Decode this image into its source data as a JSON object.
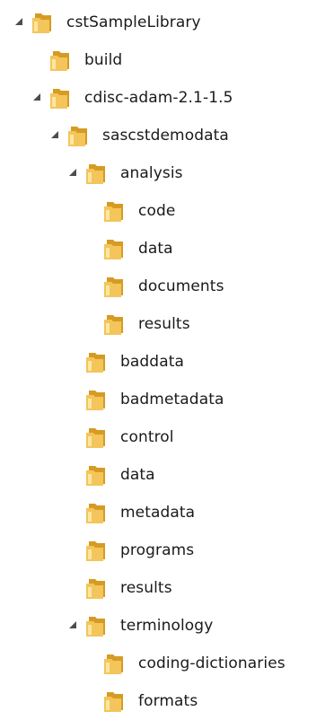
{
  "tree": {
    "nodes": [
      {
        "label": "cstSampleLibrary",
        "depth": 0,
        "expanded": true,
        "has_children": true,
        "icon": "folder-icon"
      },
      {
        "label": "build",
        "depth": 1,
        "expanded": false,
        "has_children": false,
        "icon": "folder-icon"
      },
      {
        "label": "cdisc-adam-2.1-1.5",
        "depth": 1,
        "expanded": true,
        "has_children": true,
        "icon": "folder-icon"
      },
      {
        "label": "sascstdemodata",
        "depth": 2,
        "expanded": true,
        "has_children": true,
        "icon": "folder-icon"
      },
      {
        "label": "analysis",
        "depth": 3,
        "expanded": true,
        "has_children": true,
        "icon": "folder-icon"
      },
      {
        "label": "code",
        "depth": 4,
        "expanded": false,
        "has_children": false,
        "icon": "folder-icon"
      },
      {
        "label": "data",
        "depth": 4,
        "expanded": false,
        "has_children": false,
        "icon": "folder-icon"
      },
      {
        "label": "documents",
        "depth": 4,
        "expanded": false,
        "has_children": false,
        "icon": "folder-icon"
      },
      {
        "label": "results",
        "depth": 4,
        "expanded": false,
        "has_children": false,
        "icon": "folder-icon"
      },
      {
        "label": "baddata",
        "depth": 3,
        "expanded": false,
        "has_children": false,
        "icon": "folder-icon"
      },
      {
        "label": "badmetadata",
        "depth": 3,
        "expanded": false,
        "has_children": false,
        "icon": "folder-icon"
      },
      {
        "label": "control",
        "depth": 3,
        "expanded": false,
        "has_children": false,
        "icon": "folder-icon"
      },
      {
        "label": "data",
        "depth": 3,
        "expanded": false,
        "has_children": false,
        "icon": "folder-icon"
      },
      {
        "label": "metadata",
        "depth": 3,
        "expanded": false,
        "has_children": false,
        "icon": "folder-icon"
      },
      {
        "label": "programs",
        "depth": 3,
        "expanded": false,
        "has_children": false,
        "icon": "folder-icon"
      },
      {
        "label": "results",
        "depth": 3,
        "expanded": false,
        "has_children": false,
        "icon": "folder-icon"
      },
      {
        "label": "terminology",
        "depth": 3,
        "expanded": true,
        "has_children": true,
        "icon": "folder-icon"
      },
      {
        "label": "coding-dictionaries",
        "depth": 4,
        "expanded": false,
        "has_children": false,
        "icon": "folder-icon"
      },
      {
        "label": "formats",
        "depth": 4,
        "expanded": false,
        "has_children": false,
        "icon": "folder-icon"
      }
    ]
  },
  "colors": {
    "folder_body": "#f3c55a",
    "folder_shadow": "#d69b23",
    "folder_highlight": "#ffe7a3",
    "arrow": "#4d4d4d",
    "text": "#1a1a1a"
  }
}
